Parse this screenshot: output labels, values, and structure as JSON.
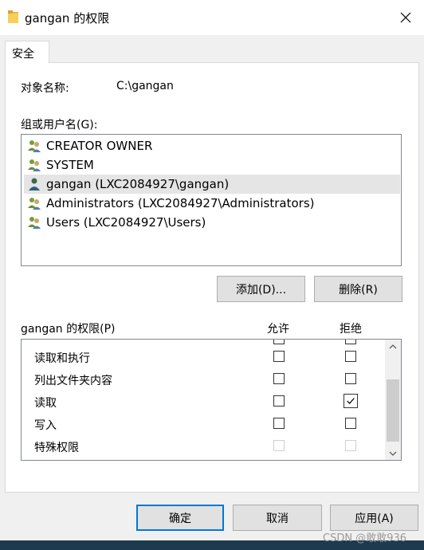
{
  "window": {
    "title": "gangan 的权限",
    "folder_icon": "folder-icon",
    "close_icon": "close-icon"
  },
  "tabs": [
    {
      "label": "安全"
    }
  ],
  "object": {
    "label": "对象名称:",
    "value": "C:\\gangan"
  },
  "groups": {
    "label": "组或用户名(G):",
    "items": [
      {
        "name": "CREATOR OWNER",
        "icon": "user-group-icon"
      },
      {
        "name": "SYSTEM",
        "icon": "user-group-icon"
      },
      {
        "name": "gangan (LXC2084927\\gangan)",
        "icon": "user-icon",
        "selected": true
      },
      {
        "name": "Administrators (LXC2084927\\Administrators)",
        "icon": "user-group-icon"
      },
      {
        "name": "Users (LXC2084927\\Users)",
        "icon": "user-group-icon"
      }
    ],
    "add_label": "添加(D)...",
    "remove_label": "删除(R)"
  },
  "permissions": {
    "label": "gangan 的权限(P)",
    "allow_header": "允许",
    "deny_header": "拒绝",
    "rows": [
      {
        "name": "读取和执行",
        "allow": false,
        "deny": false,
        "disabled": false
      },
      {
        "name": "列出文件夹内容",
        "allow": false,
        "deny": false,
        "disabled": false
      },
      {
        "name": "读取",
        "allow": false,
        "deny": true,
        "disabled": false
      },
      {
        "name": "写入",
        "allow": false,
        "deny": false,
        "disabled": false
      },
      {
        "name": "特殊权限",
        "allow": false,
        "deny": false,
        "disabled": true
      }
    ]
  },
  "footer": {
    "ok_label": "确定",
    "cancel_label": "取消",
    "apply_label": "应用(A)"
  },
  "watermark": "CSDN @敢敢936",
  "colors": {
    "accent": "#0078d7",
    "selection": "#e5e5e5"
  }
}
